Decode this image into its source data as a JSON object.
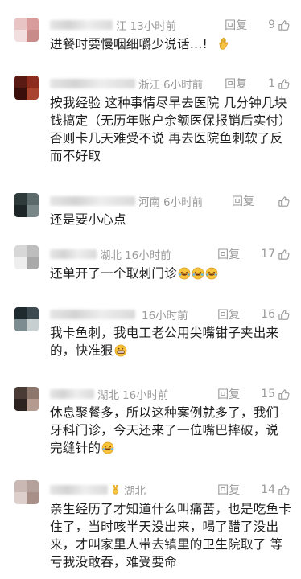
{
  "comments": [
    {
      "location": "江",
      "time": "13小时前",
      "reply": "回复",
      "likes": "9",
      "text": "进餐时要慢咽细嚼少说话…!",
      "emoji": "hand-clap-icon",
      "avatar_colors": [
        "#e8c4c4",
        "#d89c9c",
        "#f2dede",
        "#c98a8a"
      ]
    },
    {
      "location": "浙江",
      "time": "6小时前",
      "reply": "回复",
      "likes": "1",
      "text": "按我经验 这种事情尽早去医院 几分钟几块钱搞定（无历年账户余额医保报销后实付）否则卡几天难受不说 再去医院鱼刺软了反而不好取",
      "avatar_colors": [
        "#5a1a14",
        "#8b2c1f",
        "#3a0f0b",
        "#a8432f"
      ]
    },
    {
      "location": "河南",
      "time": "6小时前",
      "reply": "回复",
      "likes": "",
      "text": "还是要小心点",
      "avatar_colors": [
        "#2f3a3b",
        "#5c6a6b",
        "#1d2526",
        "#7a8788"
      ]
    },
    {
      "location": "湖北",
      "time": "16小时前",
      "reply": "回复",
      "likes": "17",
      "text": "还单开了一个取刺门诊",
      "emoji_count": 3,
      "avatar_colors": [
        "#d7d7d7",
        "#bdbdbd",
        "#eeeeee",
        "#a9a9a9"
      ]
    },
    {
      "location": "",
      "time": "16小时前",
      "reply": "回复",
      "likes": "16",
      "text": "我卡鱼刺，我电工老公用尖嘴钳子夹出来的，快准狠",
      "avatar_colors": [
        "#1f2a2e",
        "#3d4b50",
        "#7d8c90",
        "#c7cfd1"
      ]
    },
    {
      "location": "湖北",
      "time": "16小时前",
      "reply": "回复",
      "likes": "15",
      "text": "休息聚餐多，所以这种案例就多了，我们牙科门诊，今天还来了一位嘴巴摔破，说完缝针的",
      "avatar_colors": [
        "#4a3b36",
        "#8d766c",
        "#2c221f",
        "#b59b8f"
      ]
    },
    {
      "location": "湖北",
      "time": "",
      "reply": "回复",
      "likes": "14",
      "text": "亲生经历了才知道什么叫痛苦，也是吃鱼卡住了，当时咳半天没出来，喝了醋了没出来，才叫家里人带去镇里的卫生院取了 等亏我没敢吞，难受要命",
      "avatar_colors": [
        "#c9b8b3",
        "#b5a19b",
        "#ddd0cc",
        "#a88f88"
      ]
    }
  ]
}
